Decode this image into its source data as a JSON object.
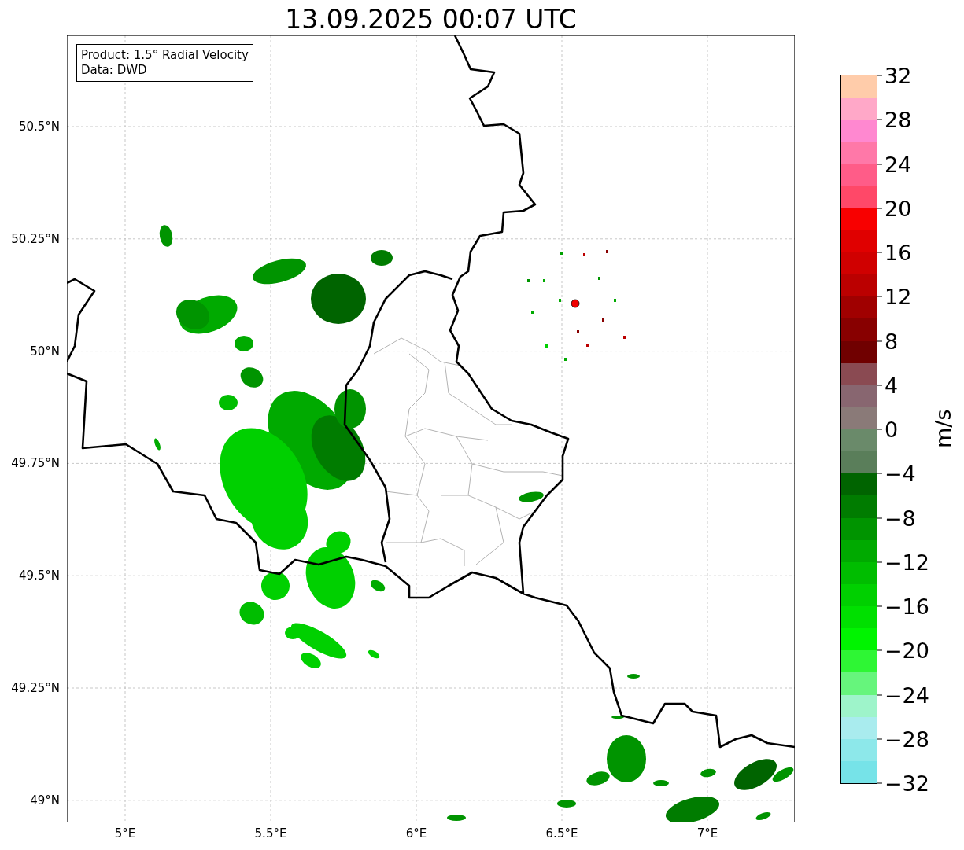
{
  "title": "13.09.2025 00:07 UTC",
  "info_box": {
    "lines": [
      "Product: 1.5° Radial Velocity",
      "Data: DWD"
    ]
  },
  "map": {
    "x_ticks": [
      "5°E",
      "5.5°E",
      "6°E",
      "6.5°E",
      "7°E"
    ],
    "y_ticks": [
      "50.5°N",
      "50.25°N",
      "50°N",
      "49.75°N",
      "49.5°N",
      "49.25°N",
      "49°N"
    ]
  },
  "colorbar": {
    "label": "m/s",
    "ticks": [
      "32",
      "28",
      "24",
      "20",
      "16",
      "12",
      "8",
      "4",
      "0",
      "−4",
      "−8",
      "−12",
      "−16",
      "−20",
      "−24",
      "−28",
      "−32"
    ],
    "segments": [
      {
        "color": "#ffccaa"
      },
      {
        "color": "#ffa8c8"
      },
      {
        "color": "#ff88d0"
      },
      {
        "color": "#ff78a8"
      },
      {
        "color": "#ff5c88"
      },
      {
        "color": "#ff4868"
      },
      {
        "color": "#f80000"
      },
      {
        "color": "#e00000"
      },
      {
        "color": "#d00000"
      },
      {
        "color": "#bb0000"
      },
      {
        "color": "#a00000"
      },
      {
        "color": "#880000"
      },
      {
        "color": "#700000"
      },
      {
        "color": "#8a4a52"
      },
      {
        "color": "#886670"
      },
      {
        "color": "#8a7a78"
      },
      {
        "color": "#6a8a6a"
      },
      {
        "color": "#5a7e5a"
      },
      {
        "color": "#006400"
      },
      {
        "color": "#007c00"
      },
      {
        "color": "#009400"
      },
      {
        "color": "#00aa00"
      },
      {
        "color": "#00bd00"
      },
      {
        "color": "#00d000"
      },
      {
        "color": "#00e000"
      },
      {
        "color": "#00f400"
      },
      {
        "color": "#2ef634"
      },
      {
        "color": "#66f57c"
      },
      {
        "color": "#9ef4ca"
      },
      {
        "color": "#a9ecee"
      },
      {
        "color": "#8de8ea"
      },
      {
        "color": "#76e3e8"
      }
    ]
  }
}
